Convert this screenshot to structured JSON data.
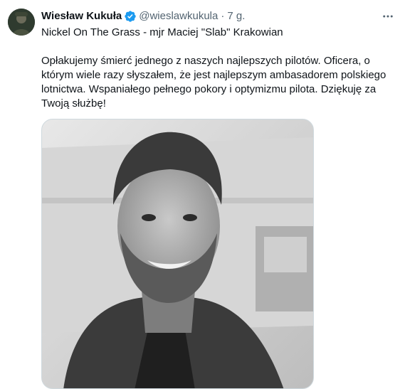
{
  "author": {
    "name": "Wiesław Kukuła",
    "handle": "@wieslawkukula",
    "separator": "·",
    "time": "7 g."
  },
  "tweet": {
    "title_line": "Nickel On The Grass - mjr Maciej \"Slab\" Krakowian",
    "body": "Opłakujemy śmierć jednego z naszych najlepszych pilotów. Oficera, o którym wiele razy słyszałem, że jest najlepszym ambasadorem polskiego lotnictwa. Wspaniałego pełnego pokory i optymizmu pilota. Dziękuję za Twoją służbę!"
  },
  "icons": {
    "verified": "verified-badge-icon",
    "more": "more-options-icon"
  },
  "colors": {
    "text_primary": "#0f1419",
    "text_secondary": "#536471",
    "verified_blue": "#1d9bf0"
  }
}
